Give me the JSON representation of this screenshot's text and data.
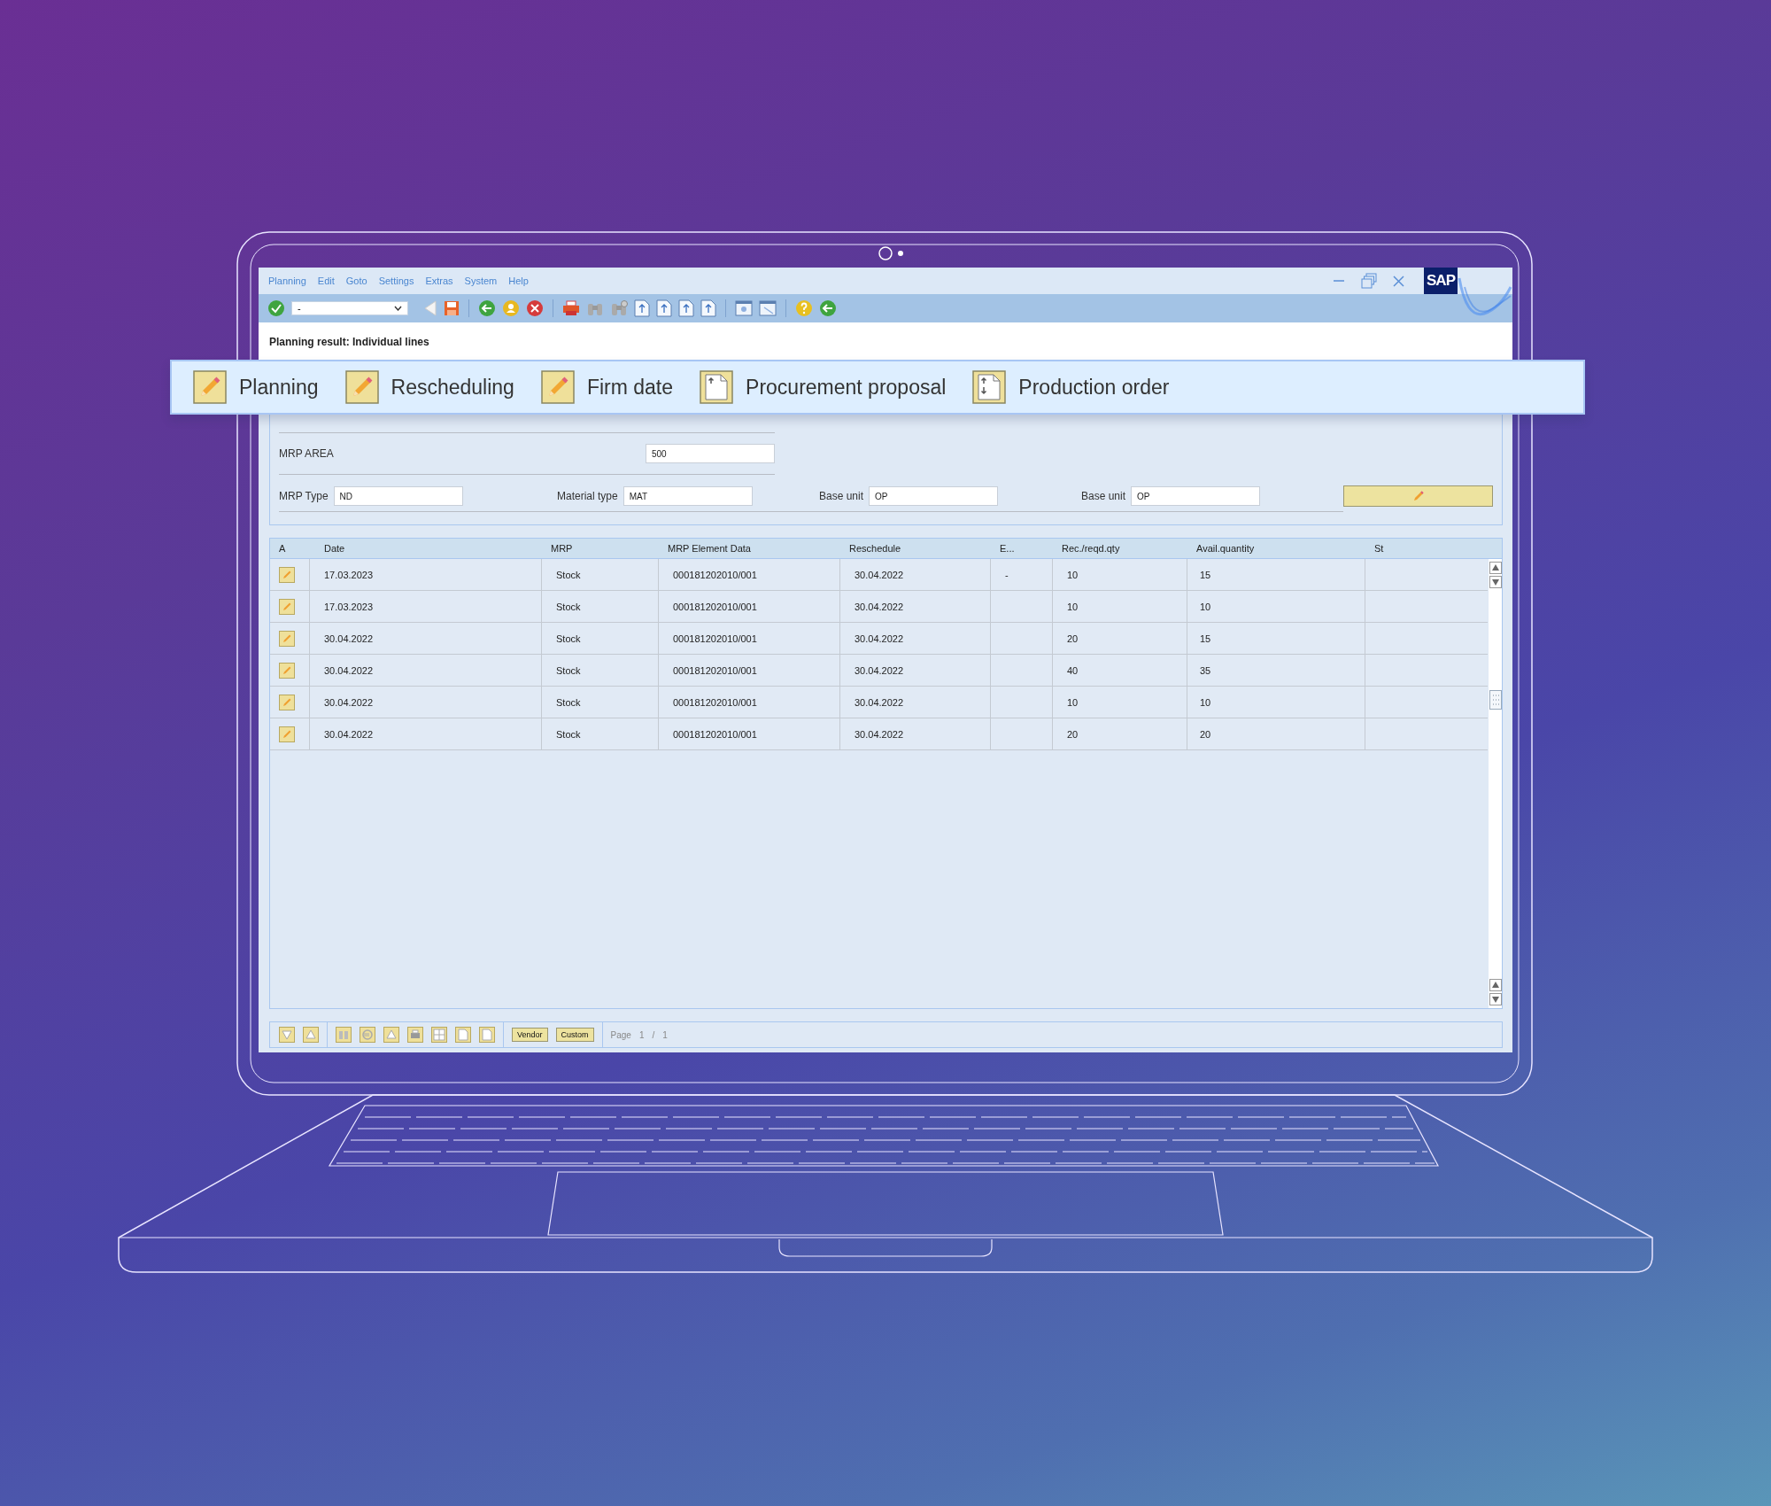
{
  "window": {
    "menu": [
      "Planning",
      "Edit",
      "Goto",
      "Settings",
      "Extras",
      "System",
      "Help"
    ],
    "dropdown": {
      "value": "-"
    },
    "logo": "SAP",
    "title": "Planning result: Individual lines"
  },
  "action_bar": [
    {
      "label": "Planning",
      "kind": "edit"
    },
    {
      "label": "Rescheduling",
      "kind": "edit"
    },
    {
      "label": "Firm date",
      "kind": "edit"
    },
    {
      "label": "Procurement proposal",
      "kind": "upload"
    },
    {
      "label": "Production order",
      "kind": "transfer"
    }
  ],
  "form": {
    "mrp_area": {
      "label": "MRP AREA",
      "value": "500"
    },
    "fields": [
      {
        "label": "MRP Type",
        "value": "ND"
      },
      {
        "label": "Material type",
        "value": "MAT"
      },
      {
        "label": "Base unit",
        "value": "OP"
      },
      {
        "label": "Base unit",
        "value": "OP"
      }
    ]
  },
  "table": {
    "columns": [
      "A",
      "Date",
      "MRP",
      "MRP Element Data",
      "Reschedule",
      "E...",
      "Rec./reqd.qty",
      "Avail.quantity",
      "St"
    ],
    "rows": [
      {
        "date": "17.03.2023",
        "mrp": "Stock",
        "element": "000181202010/001",
        "reschedule": "30.04.2022",
        "e": "-",
        "rec": "10",
        "avail": "15"
      },
      {
        "date": "17.03.2023",
        "mrp": "Stock",
        "element": "000181202010/001",
        "reschedule": "30.04.2022",
        "rec": "10",
        "avail": "10"
      },
      {
        "date": "30.04.2022",
        "mrp": "Stock",
        "element": "000181202010/001",
        "reschedule": "30.04.2022",
        "rec": "20",
        "avail": "15"
      },
      {
        "date": "30.04.2022",
        "mrp": "Stock",
        "element": "000181202010/001",
        "reschedule": "30.04.2022",
        "rec": "40",
        "avail": "35"
      },
      {
        "date": "30.04.2022",
        "mrp": "Stock",
        "element": "000181202010/001",
        "reschedule": "30.04.2022",
        "rec": "10",
        "avail": "10"
      },
      {
        "date": "30.04.2022",
        "mrp": "Stock",
        "element": "000181202010/001",
        "reschedule": "30.04.2022",
        "rec": "20",
        "avail": "20"
      }
    ]
  },
  "footer": {
    "buttons": [
      "Vendor",
      "Custom"
    ],
    "page": {
      "label": "Page",
      "current": "1",
      "separator": "/",
      "total": "1"
    }
  }
}
